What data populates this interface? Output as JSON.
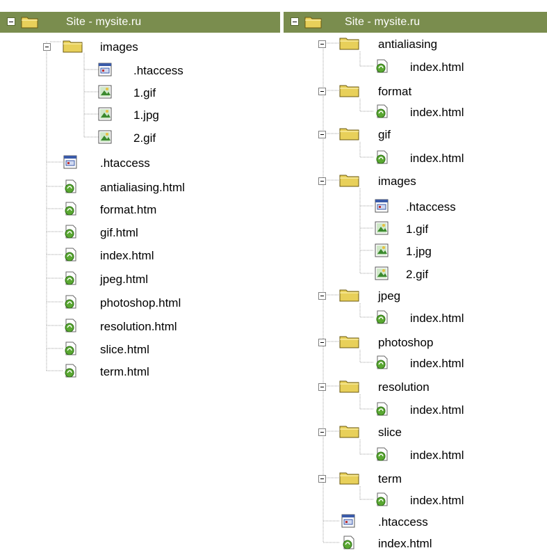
{
  "left_panel": {
    "header": {
      "title": "Site - mysite.ru"
    },
    "folder_images": {
      "label": "images"
    },
    "images_children": [
      ".htaccess",
      "1.gif",
      "1.jpg",
      "2.gif"
    ],
    "root_files": [
      ".htaccess",
      "antialiasing.html",
      "format.htm",
      "gif.html",
      "index.html",
      "jpeg.html",
      "photoshop.html",
      "resolution.html",
      "slice.html",
      "term.html"
    ]
  },
  "right_panel": {
    "header": {
      "title": "Site - mysite.ru"
    },
    "folders": [
      {
        "label": "antialiasing",
        "children": [
          "index.html"
        ]
      },
      {
        "label": "format",
        "children": [
          "index.html"
        ]
      },
      {
        "label": "gif",
        "children": [
          "index.html"
        ]
      },
      {
        "label": "images",
        "children": [
          ".htaccess",
          "1.gif",
          "1.jpg",
          "2.gif"
        ]
      },
      {
        "label": "jpeg",
        "children": [
          "index.html"
        ]
      },
      {
        "label": "photoshop",
        "children": [
          "index.html"
        ]
      },
      {
        "label": "resolution",
        "children": [
          "index.html"
        ]
      },
      {
        "label": "slice",
        "children": [
          "index.html"
        ]
      },
      {
        "label": "term",
        "children": [
          "index.html"
        ]
      }
    ],
    "root_files": [
      ".htaccess",
      "index.html"
    ]
  },
  "icons": {
    "folder": "folder-icon",
    "html": "html-file-icon",
    "image": "image-file-icon",
    "htaccess": "htaccess-file-icon"
  },
  "colors": {
    "header": "#7a8d4e",
    "folder": "#e8d05a",
    "tree_line": "#a0a0a0"
  }
}
